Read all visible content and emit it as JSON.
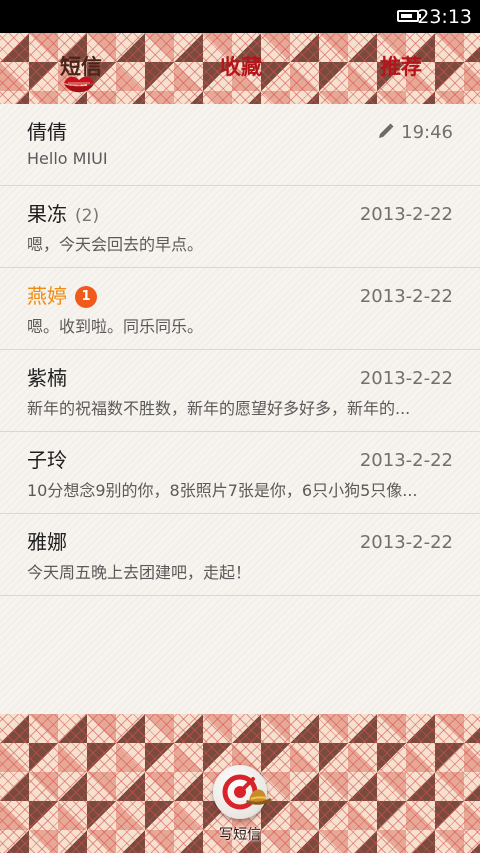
{
  "status_bar": {
    "time": "23:13",
    "battery_level": 0.8
  },
  "tabs": [
    {
      "label": "短信",
      "active": true
    },
    {
      "label": "收藏",
      "active": false
    },
    {
      "label": "推荐",
      "active": false
    }
  ],
  "conversations": [
    {
      "name": "倩倩",
      "count": "",
      "unread": "",
      "date": "19:46",
      "draft": true,
      "snippet": "Hello MIUI"
    },
    {
      "name": "果冻",
      "count": "(2)",
      "unread": "",
      "date": "2013-2-22",
      "draft": false,
      "snippet": "嗯，今天会回去的早点。"
    },
    {
      "name": "燕婷",
      "count": "",
      "unread": "1",
      "date": "2013-2-22",
      "draft": false,
      "snippet": "嗯。收到啦。同乐同乐。"
    },
    {
      "name": "紫楠",
      "count": "",
      "unread": "",
      "date": "2013-2-22",
      "draft": false,
      "snippet": "新年的祝福数不胜数，新年的愿望好多好多，新年的..."
    },
    {
      "name": "子玲",
      "count": "",
      "unread": "",
      "date": "2013-2-22",
      "draft": false,
      "snippet": "10分想念9别的你，8张照片7张是你，6只小狗5只像..."
    },
    {
      "name": "雅娜",
      "count": "",
      "unread": "",
      "date": "2013-2-22",
      "draft": false,
      "snippet": "今天周五晚上去团建吧，走起！"
    }
  ],
  "compose": {
    "label": "写短信"
  },
  "colors": {
    "tab_active": "#4a231b",
    "tab_inactive": "#b3161a",
    "unread_name": "#f08a10",
    "unread_badge": "#f05a1a"
  }
}
